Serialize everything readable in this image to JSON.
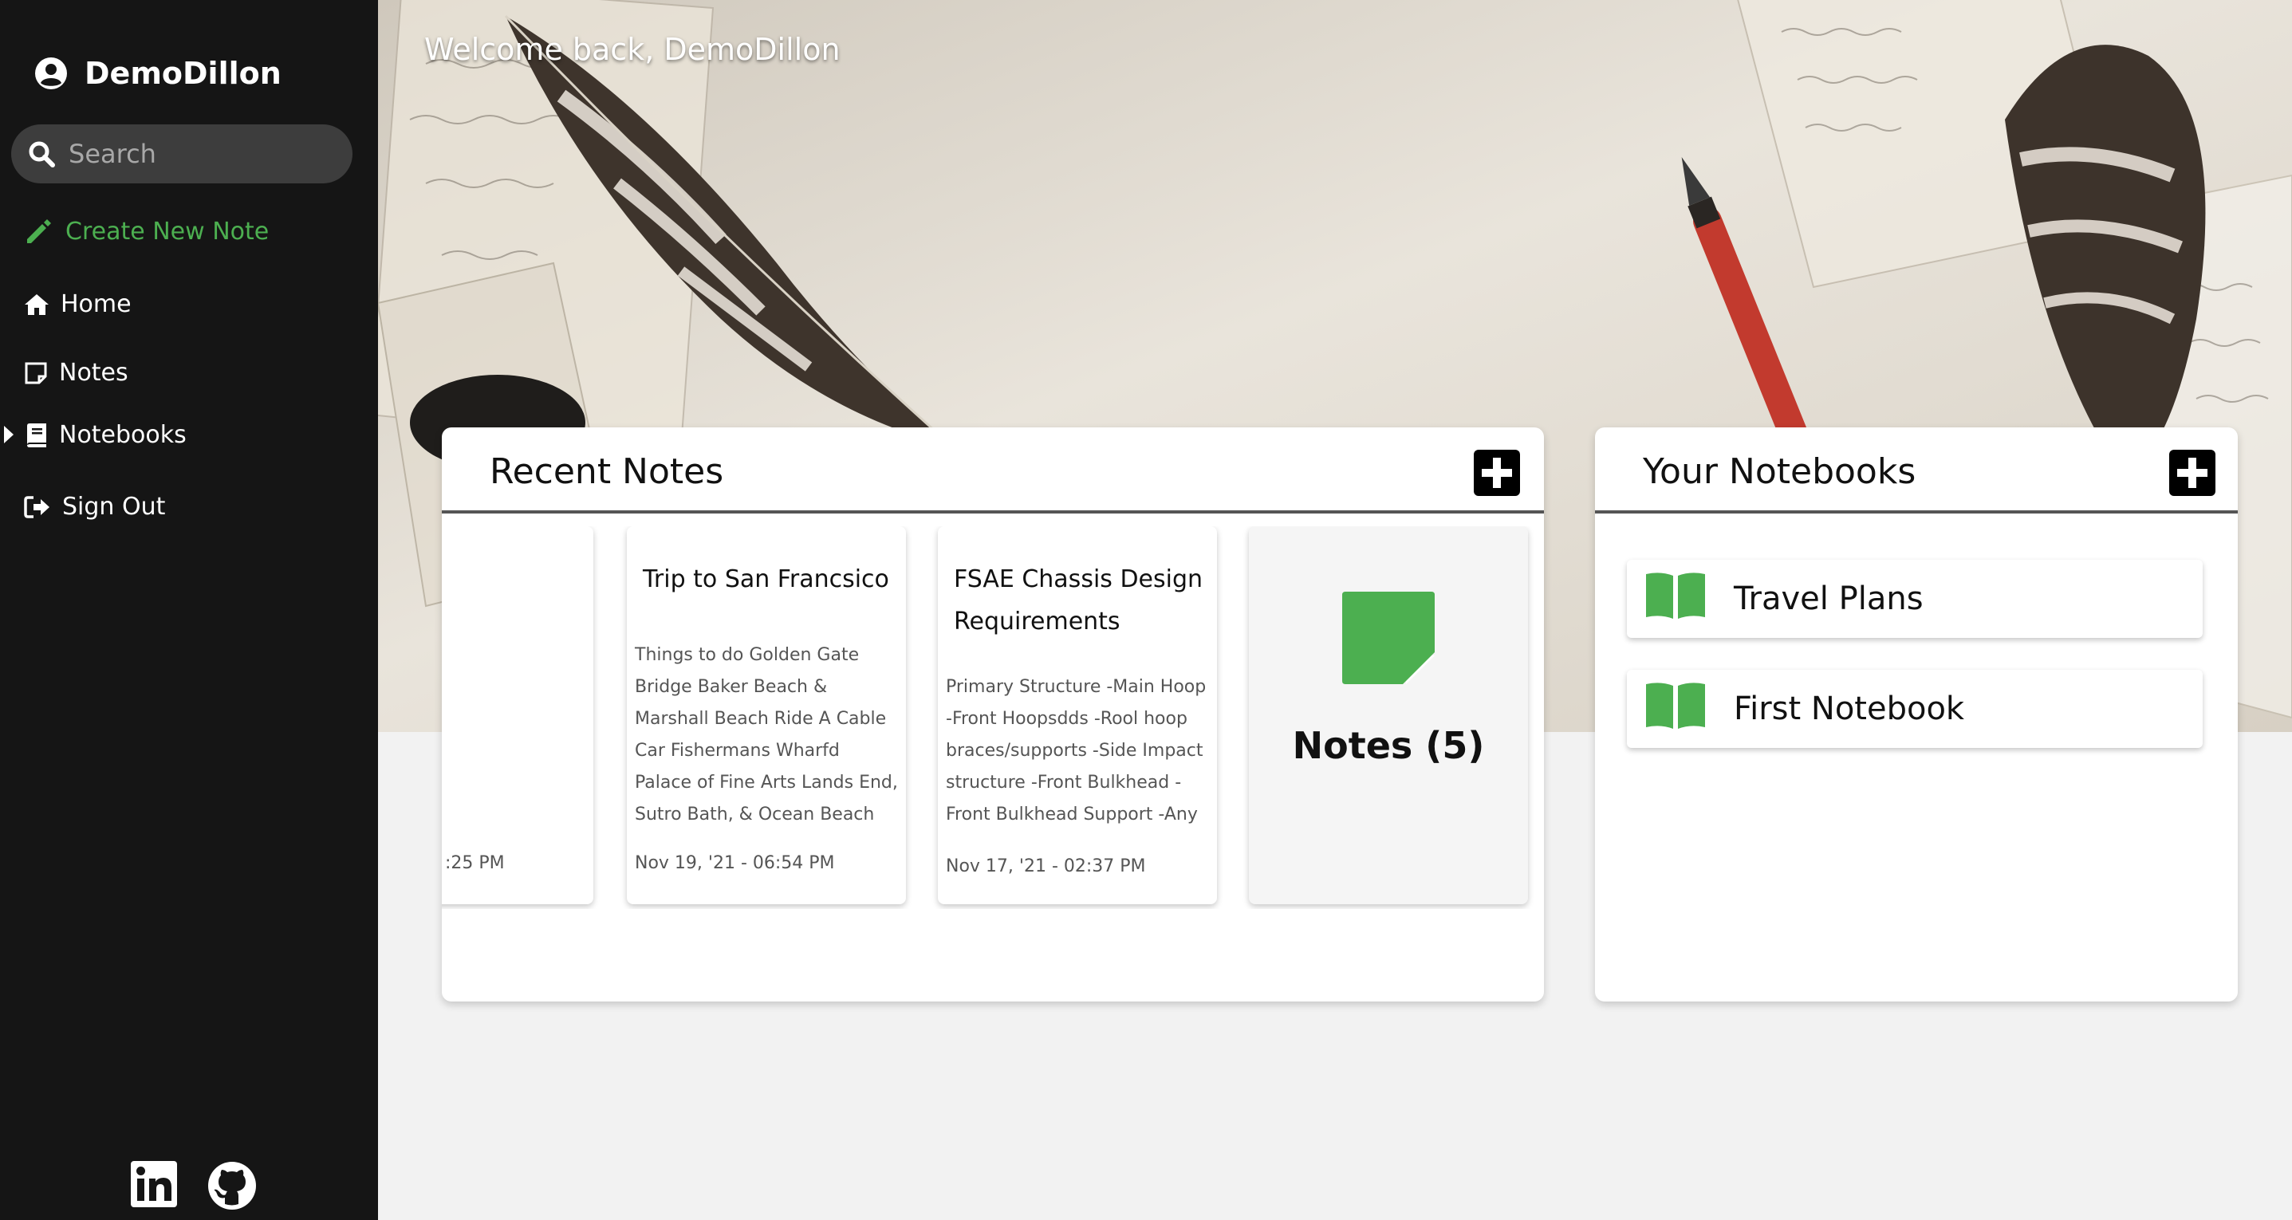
{
  "sidebar": {
    "username": "DemoDillon",
    "search_placeholder": "Search",
    "create_note_label": "Create New Note",
    "nav": {
      "home": "Home",
      "notes": "Notes",
      "notebooks": "Notebooks",
      "sign_out": "Sign Out"
    },
    "social": [
      "linkedin-icon",
      "github-icon"
    ]
  },
  "header": {
    "welcome": "Welcome back, DemoDillon"
  },
  "recent_notes": {
    "title": "Recent Notes",
    "cards": [
      {
        "title": "",
        "body": "",
        "date": ":25 PM"
      },
      {
        "title": "Trip to San Francsico",
        "body": "Things to do Golden Gate Bridge Baker Beach & Marshall Beach Ride A Cable Car Fishermans Wharfd Palace of Fine Arts Lands End, Sutro Bath, & Ocean Beach",
        "date": "Nov 19, '21 - 06:54 PM"
      },
      {
        "title": "FSAE Chassis Design Requirements",
        "body": "Primary Structure -Main Hoop -Front Hoopsdds -Rool hoop braces/supports -Side Impact structure -Front Bulkhead -Front Bulkhead Support -Any",
        "date": "Nov 17, '21 - 02:37 PM"
      }
    ],
    "summary_label": "Notes (5)"
  },
  "notebooks": {
    "title": "Your Notebooks",
    "items": [
      "Travel Plans",
      "First Notebook"
    ]
  },
  "colors": {
    "accent": "#4caf50",
    "sidebar_bg": "#151515"
  }
}
